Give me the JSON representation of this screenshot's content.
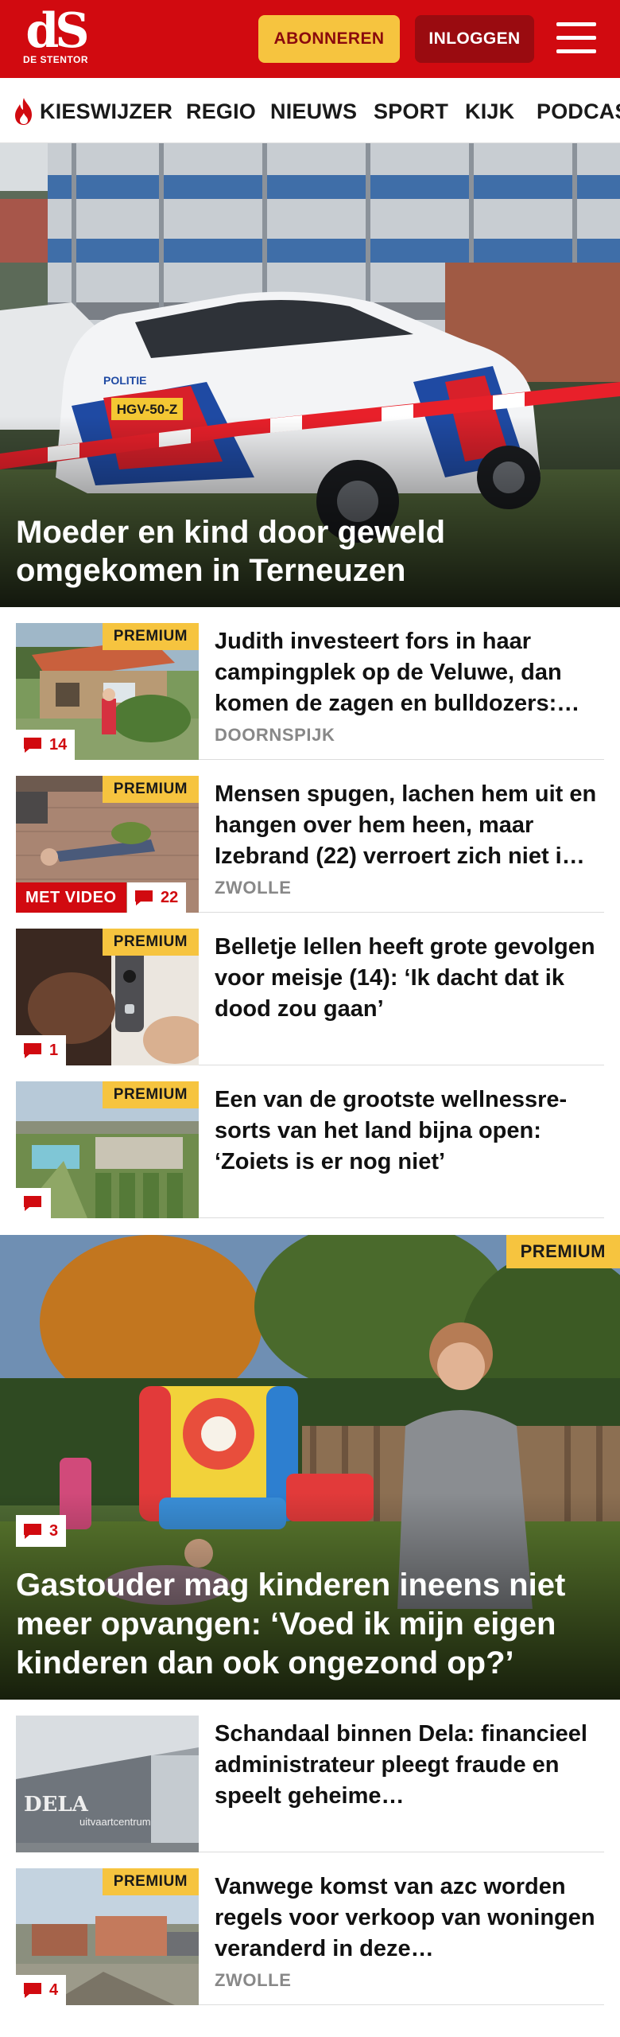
{
  "header": {
    "logo_letters": "dS",
    "logo_name": "DE STENTOR",
    "subscribe_label": "ABONNEREN",
    "login_label": "INLOGGEN",
    "colors": {
      "brand_red": "#d10a10",
      "login_red": "#9a0b10",
      "subscribe_yellow": "#f6c43f"
    }
  },
  "nav": {
    "items": [
      {
        "label": "KIESWIJZER",
        "icon": "flame-icon"
      },
      {
        "label": "REGIO"
      },
      {
        "label": "NIEUWS"
      },
      {
        "label": "SPORT"
      },
      {
        "label": "KIJK"
      },
      {
        "label": "PODCAST"
      }
    ]
  },
  "hero": {
    "title": "Moeder en kind door geweld omgekomen in Terneuzen",
    "plate": "HGV-50-Z",
    "car_text": "POLITIE"
  },
  "articles": [
    {
      "premium": "PREMIUM",
      "title": "Judith investeert fors in haar campingplek op de Veluwe, dan komen de zagen en bulldozers:…",
      "place": "DOORNSPIJK",
      "comments": "14"
    },
    {
      "premium": "PREMIUM",
      "title": "Mensen spugen, lachen hem uit en hangen over hem heen, maar Izebrand (22) verroert zich niet i…",
      "place": "ZWOLLE",
      "comments": "22",
      "video": "MET VIDEO"
    },
    {
      "premium": "PREMIUM",
      "title": "Belletje lellen heeft grote gevolgen voor meisje (14): ‘Ik dacht dat ik dood zou gaan’",
      "comments": "1"
    },
    {
      "premium": "PREMIUM",
      "title": "Een van de grootste wellnessre­sorts van het land bijna open: ‘Zoiets is er nog niet’",
      "comments": ""
    }
  ],
  "feature": {
    "premium": "PREMIUM",
    "comments": "3",
    "title": "Gastouder mag kinderen ineens niet meer opvangen: ‘Voed ik mijn eigen kinderen dan ook ongezond op?’"
  },
  "articles2": [
    {
      "title": "Schandaal binnen Dela: financieel administrateur pleegt fraude en speelt geheime…",
      "sign_text": "DELA",
      "sign_sub": "uitvaartcentrum"
    },
    {
      "premium": "PREMIUM",
      "title": "Vanwege komst van azc worden regels voor verkoop van woningen veranderd in deze…",
      "place": "ZWOLLE",
      "comments": "4"
    }
  ]
}
